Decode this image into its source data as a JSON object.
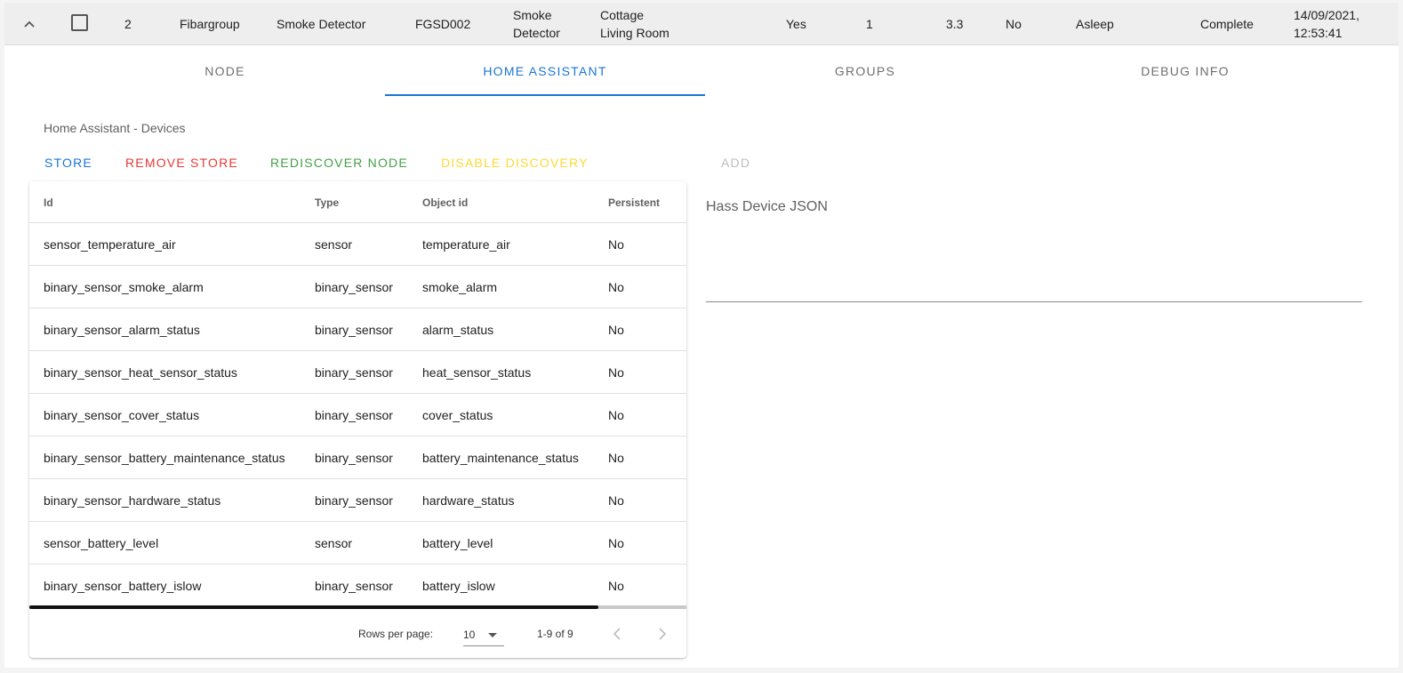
{
  "node_row": {
    "id": "2",
    "manufacturer": "Fibargroup",
    "product": "Smoke Detector",
    "product_code": "FGSD002",
    "name": "Smoke\nDetector",
    "location": "Cottage\nLiving Room",
    "secure": "Yes",
    "beaming": "1",
    "version": "3.3",
    "failed": "No",
    "status": "Asleep",
    "interview": "Complete",
    "last_active": "14/09/2021,\n12:53:41"
  },
  "tabs": [
    {
      "label": "NODE"
    },
    {
      "label": "HOME ASSISTANT"
    },
    {
      "label": "GROUPS"
    },
    {
      "label": "DEBUG INFO"
    }
  ],
  "section_title": "Home Assistant - Devices",
  "actions": {
    "store": "STORE",
    "remove_store": "REMOVE STORE",
    "rediscover": "REDISCOVER NODE",
    "disable_discovery": "DISABLE DISCOVERY",
    "add": "ADD"
  },
  "colors": {
    "primary": "#1976d2",
    "error": "#e53935",
    "success": "#43a047",
    "warning": "#fdd835",
    "disabled": "#bdbdbd"
  },
  "table": {
    "headers": {
      "id": "Id",
      "type": "Type",
      "object_id": "Object id",
      "persistent": "Persistent"
    },
    "rows": [
      {
        "id": "sensor_temperature_air",
        "type": "sensor",
        "object_id": "temperature_air",
        "persistent": "No"
      },
      {
        "id": "binary_sensor_smoke_alarm",
        "type": "binary_sensor",
        "object_id": "smoke_alarm",
        "persistent": "No"
      },
      {
        "id": "binary_sensor_alarm_status",
        "type": "binary_sensor",
        "object_id": "alarm_status",
        "persistent": "No"
      },
      {
        "id": "binary_sensor_heat_sensor_status",
        "type": "binary_sensor",
        "object_id": "heat_sensor_status",
        "persistent": "No"
      },
      {
        "id": "binary_sensor_cover_status",
        "type": "binary_sensor",
        "object_id": "cover_status",
        "persistent": "No"
      },
      {
        "id": "binary_sensor_battery_maintenance_status",
        "type": "binary_sensor",
        "object_id": "battery_maintenance_status",
        "persistent": "No"
      },
      {
        "id": "binary_sensor_hardware_status",
        "type": "binary_sensor",
        "object_id": "hardware_status",
        "persistent": "No"
      },
      {
        "id": "sensor_battery_level",
        "type": "sensor",
        "object_id": "battery_level",
        "persistent": "No"
      },
      {
        "id": "binary_sensor_battery_islow",
        "type": "binary_sensor",
        "object_id": "battery_islow",
        "persistent": "No"
      }
    ],
    "footer": {
      "rows_per_page_label": "Rows per page:",
      "rows_per_page_value": "10",
      "range": "1-9 of 9"
    }
  },
  "json_panel": {
    "label": "Hass Device JSON"
  }
}
